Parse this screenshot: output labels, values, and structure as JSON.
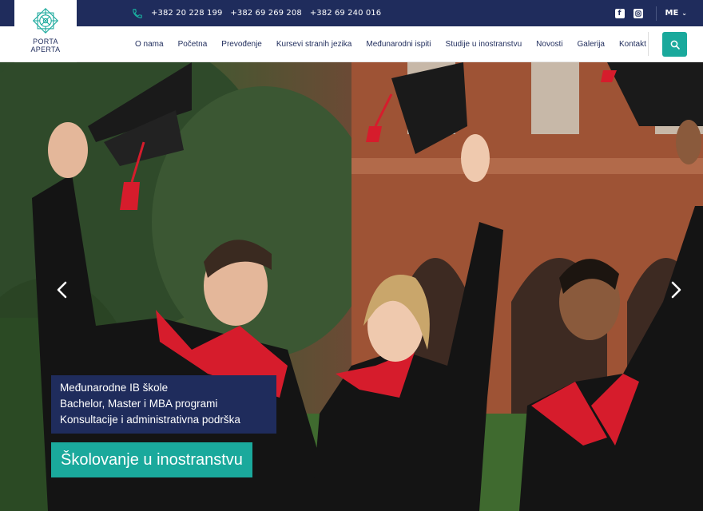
{
  "topbar": {
    "phone_icon": "phone-icon",
    "phones": [
      "+382 20 228 199",
      "+382 69 269 208",
      "+382 69 240 016"
    ],
    "social": {
      "facebook_icon": "facebook-icon",
      "instagram_icon": "instagram-icon"
    },
    "language": "ME"
  },
  "logo": {
    "line1": "PORTA",
    "line2": "APERTA"
  },
  "nav": {
    "items": [
      "O nama",
      "Početna",
      "Prevođenje",
      "Kursevi stranih jezika",
      "Međunarodni ispiti",
      "Studije u inostranstvu",
      "Novosti",
      "Galerija",
      "Kontakt"
    ]
  },
  "hero": {
    "caption_lines": [
      "Međunarodne IB škole",
      "Bachelor, Master i MBA programi",
      "Konsultacije i administrativna podrška"
    ],
    "cta": "Školovanje u inostranstvu"
  },
  "colors": {
    "navy": "#1f2c5c",
    "teal": "#1aa99c"
  }
}
